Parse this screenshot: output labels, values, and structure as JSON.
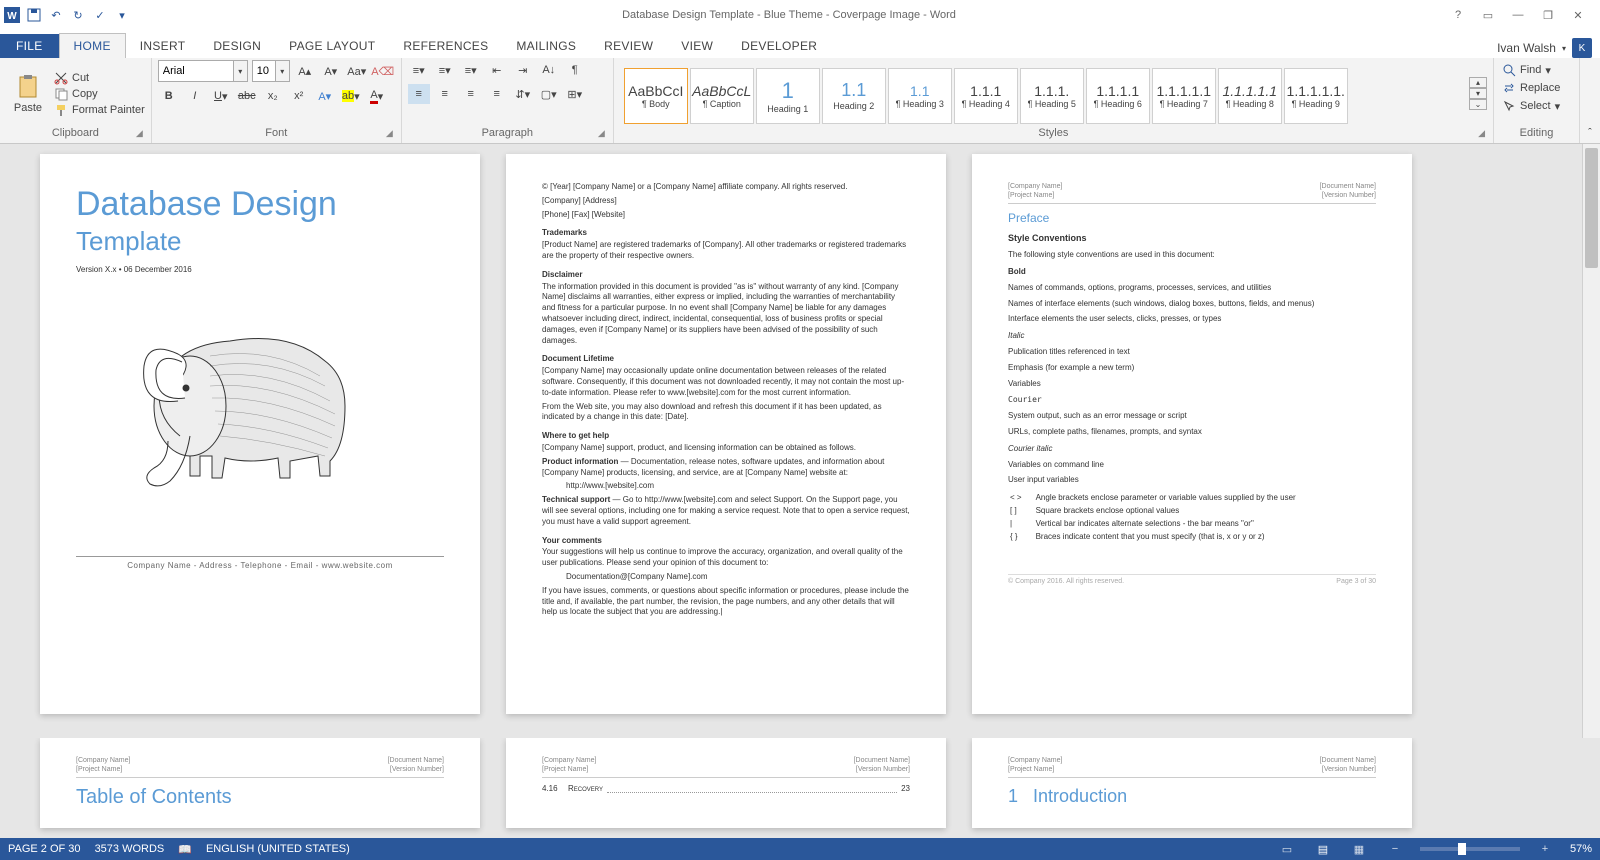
{
  "title": "Database Design Template - Blue Theme - Coverpage Image - Word",
  "user": "Ivan Walsh",
  "avatar_initial": "K",
  "tabs": [
    "FILE",
    "HOME",
    "INSERT",
    "DESIGN",
    "PAGE LAYOUT",
    "REFERENCES",
    "MAILINGS",
    "REVIEW",
    "VIEW",
    "DEVELOPER"
  ],
  "active_tab": 1,
  "clipboard": {
    "paste": "Paste",
    "cut": "Cut",
    "copy": "Copy",
    "format_painter": "Format Painter",
    "label": "Clipboard"
  },
  "font": {
    "name": "Arial",
    "size": "10",
    "label": "Font"
  },
  "paragraph": {
    "label": "Paragraph"
  },
  "styles_label": "Styles",
  "styles": [
    {
      "preview": "AaBbCcI",
      "name": "¶ Body",
      "cls": ""
    },
    {
      "preview": "AaBbCcL",
      "name": "¶ Caption",
      "cls": "i"
    },
    {
      "preview": "1",
      "name": "Heading 1",
      "cls": "h1"
    },
    {
      "preview": "1.1",
      "name": "Heading 2",
      "cls": "h2"
    },
    {
      "preview": "1.1",
      "name": "¶ Heading 3",
      "cls": "h3"
    },
    {
      "preview": "1.1.1",
      "name": "¶ Heading 4",
      "cls": ""
    },
    {
      "preview": "1.1.1.",
      "name": "¶ Heading 5",
      "cls": ""
    },
    {
      "preview": "1.1.1.1",
      "name": "¶ Heading 6",
      "cls": ""
    },
    {
      "preview": "1.1.1.1.1",
      "name": "¶ Heading 7",
      "cls": ""
    },
    {
      "preview": "1.1.1.1.1",
      "name": "¶ Heading 8",
      "cls": "i"
    },
    {
      "preview": "1.1.1.1.1.",
      "name": "¶ Heading 9",
      "cls": ""
    }
  ],
  "editing": {
    "find": "Find",
    "replace": "Replace",
    "select": "Select",
    "label": "Editing"
  },
  "page1": {
    "title1": "Database Design",
    "title2": "Template",
    "version": "Version X.x • 06 December 2016",
    "footer": "Company Name - Address - Telephone - Email - www.website.com"
  },
  "page2": {
    "copyright": "© [Year] [Company Name] or a [Company Name] affiliate company. All rights reserved.",
    "addr": "[Company] [Address]",
    "contact": "[Phone] [Fax] [Website]",
    "trademarks_h": "Trademarks",
    "trademarks": "[Product Name] are registered trademarks of [Company]. All other trademarks or registered trademarks are the property of their respective owners.",
    "disclaimer_h": "Disclaimer",
    "disclaimer": "The information provided in this document is provided \"as is\" without warranty of any kind. [Company Name] disclaims all warranties, either express or implied, including the warranties of merchantability and fitness for a particular purpose. In no event shall [Company Name] be liable for any damages whatsoever including direct, indirect, incidental, consequential, loss of business profits or special damages, even if [Company Name] or its suppliers have been advised of the possibility of such damages.",
    "lifetime_h": "Document Lifetime",
    "lifetime1": "[Company Name] may occasionally update online documentation between releases of the related software. Consequently, if this document was not downloaded recently, it may not contain the most up-to-date information. Please refer to www.[website].com for the most current information.",
    "lifetime2": "From the Web site, you may also download and refresh this document if it has been updated, as indicated by a change in this date: [Date].",
    "help_h": "Where to get help",
    "help": "[Company Name] support, product, and licensing information can be obtained as follows.",
    "prodinfo_h": "Product information",
    "prodinfo": " — Documentation, release notes, software updates, and information about [Company Name] products, licensing, and service, are at [Company Name] website at:",
    "produrl": "http://www.[website].com",
    "tech_h": "Technical support",
    "tech": " — Go to http://www.[website].com and select Support. On the Support page, you will see several options, including one for making a service request. Note that to open a service request, you must have a valid support agreement.",
    "comments_h": "Your comments",
    "comments1": "Your suggestions will help us continue to improve the accuracy, organization, and overall quality of the user publications. Please send your opinion of this document to:",
    "docemail": "Documentation@[Company Name].com",
    "comments2": "If you have issues, comments, or questions about specific information or procedures, please include the title and, if available, the part number, the revision, the page numbers, and any other details that will help us locate the subject that you are addressing.|"
  },
  "page3": {
    "hdr_l1": "[Company Name]",
    "hdr_l2": "[Project Name]",
    "hdr_r1": "[Document Name]",
    "hdr_r2": "[Version Number]",
    "preface": "Preface",
    "styleconv": "Style Conventions",
    "intro": "The following style conventions are used in this document:",
    "items": [
      {
        "k": "Bold",
        "kc": "k",
        "v": "Names of commands, options, programs, processes, services, and utilities"
      },
      {
        "k": "",
        "kc": "",
        "v": "Names of interface elements (such windows, dialog boxes, buttons, fields, and menus)"
      },
      {
        "k": "",
        "kc": "",
        "v": "Interface elements the user selects, clicks, presses, or types"
      },
      {
        "k": "Italic",
        "kc": "ki",
        "v": "Publication titles referenced in text"
      },
      {
        "k": "",
        "kc": "",
        "v": "Emphasis (for example a new term)"
      },
      {
        "k": "",
        "kc": "",
        "v": "Variables"
      },
      {
        "k": "Courier",
        "kc": "km",
        "v": "System output, such as an error message or script"
      },
      {
        "k": "",
        "kc": "",
        "v": "URLs, complete paths, filenames, prompts, and syntax"
      },
      {
        "k": "Courier italic",
        "kc": "ki",
        "v": "Variables on command line"
      },
      {
        "k": "",
        "kc": "",
        "v": "User input variables"
      }
    ],
    "symbols": [
      {
        "s": "< >",
        "v": "Angle brackets enclose parameter or variable values supplied by the user"
      },
      {
        "s": "[ ]",
        "v": "Square brackets enclose optional values"
      },
      {
        "s": "|",
        "v": "Vertical bar indicates alternate selections - the bar means \"or\""
      },
      {
        "s": "{ }",
        "v": "Braces indicate content that you must specify (that is, x or y or z)"
      }
    ],
    "ftr_l": "© Company 2016. All rights reserved.",
    "ftr_r": "Page 3 of 30"
  },
  "page5_title": "Table of Contents",
  "page6": {
    "num": "4.16",
    "name": "Recovery",
    "pg": "23"
  },
  "page8": {
    "num": "1",
    "title": "Introduction"
  },
  "status": {
    "page": "PAGE 2 OF 30",
    "words": "3573 WORDS",
    "lang": "ENGLISH (UNITED STATES)",
    "zoom": "57%"
  }
}
